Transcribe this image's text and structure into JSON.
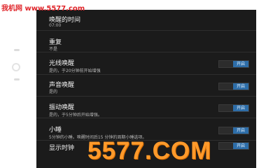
{
  "watermark_top": "我机网 www.5577.com",
  "logo_text": "5577.COM",
  "settings": [
    {
      "title": "唤醒的时间",
      "sub": "07:00",
      "toggle": null
    },
    {
      "title": "重复",
      "sub": "不是",
      "toggle": null
    },
    {
      "title": "光线唤醒",
      "sub": "是的，于20分钟前开始增强",
      "toggle": "开启"
    },
    {
      "title": "声音唤醒",
      "sub": "是的",
      "toggle": "开启"
    },
    {
      "title": "振动唤醒",
      "sub": "是的，于5分钟后开始增强。",
      "toggle": "开启"
    },
    {
      "title": "小睡",
      "sub": "5分钟的小睡。唤醒时间后15 分钟的周期小睡选项。",
      "toggle": "开启"
    },
    {
      "title": "显示时钟",
      "sub": "",
      "toggle": "开启"
    }
  ]
}
